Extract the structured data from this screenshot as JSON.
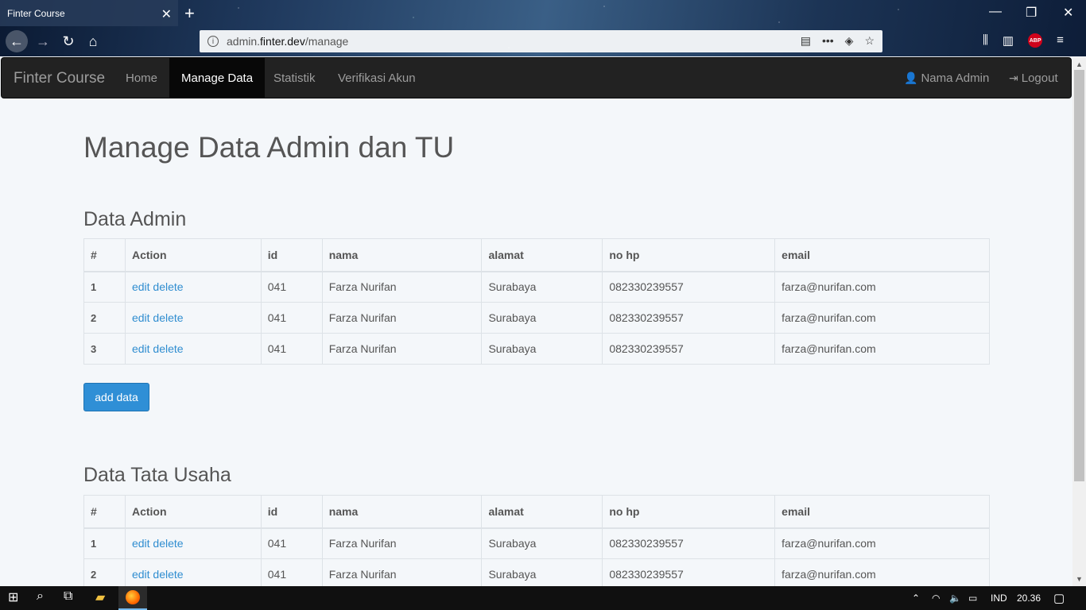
{
  "browser": {
    "tab_title": "Finter Course",
    "url_prefix": "admin.",
    "url_host": "finter.dev",
    "url_path": "/manage",
    "abp_label": "ABP"
  },
  "navbar": {
    "brand": "Finter Course",
    "items": [
      {
        "label": "Home"
      },
      {
        "label": "Manage Data"
      },
      {
        "label": "Statistik"
      },
      {
        "label": "Verifikasi Akun"
      }
    ],
    "user_label": "Nama Admin",
    "logout_label": "Logout"
  },
  "main": {
    "title": "Manage Data Admin dan TU",
    "admin_section": {
      "title": "Data Admin",
      "headers": [
        "#",
        "Action",
        "id",
        "nama",
        "alamat",
        "no hp",
        "email"
      ],
      "rows": [
        {
          "no": "1",
          "edit": "edit",
          "delete": "delete",
          "id": "041",
          "nama": "Farza Nurifan",
          "alamat": "Surabaya",
          "hp": "082330239557",
          "email": "farza@nurifan.com"
        },
        {
          "no": "2",
          "edit": "edit",
          "delete": "delete",
          "id": "041",
          "nama": "Farza Nurifan",
          "alamat": "Surabaya",
          "hp": "082330239557",
          "email": "farza@nurifan.com"
        },
        {
          "no": "3",
          "edit": "edit",
          "delete": "delete",
          "id": "041",
          "nama": "Farza Nurifan",
          "alamat": "Surabaya",
          "hp": "082330239557",
          "email": "farza@nurifan.com"
        }
      ],
      "add_label": "add data"
    },
    "tu_section": {
      "title": "Data Tata Usaha",
      "headers": [
        "#",
        "Action",
        "id",
        "nama",
        "alamat",
        "no hp",
        "email"
      ],
      "rows": [
        {
          "no": "1",
          "edit": "edit",
          "delete": "delete",
          "id": "041",
          "nama": "Farza Nurifan",
          "alamat": "Surabaya",
          "hp": "082330239557",
          "email": "farza@nurifan.com"
        },
        {
          "no": "2",
          "edit": "edit",
          "delete": "delete",
          "id": "041",
          "nama": "Farza Nurifan",
          "alamat": "Surabaya",
          "hp": "082330239557",
          "email": "farza@nurifan.com"
        }
      ]
    }
  },
  "taskbar": {
    "lang": "IND",
    "time": "20.36"
  },
  "colors": {
    "navbar_bg": "#222222",
    "link": "#2f8dd0",
    "button": "#2f8fd6",
    "page_bg": "#f4f7fa"
  }
}
